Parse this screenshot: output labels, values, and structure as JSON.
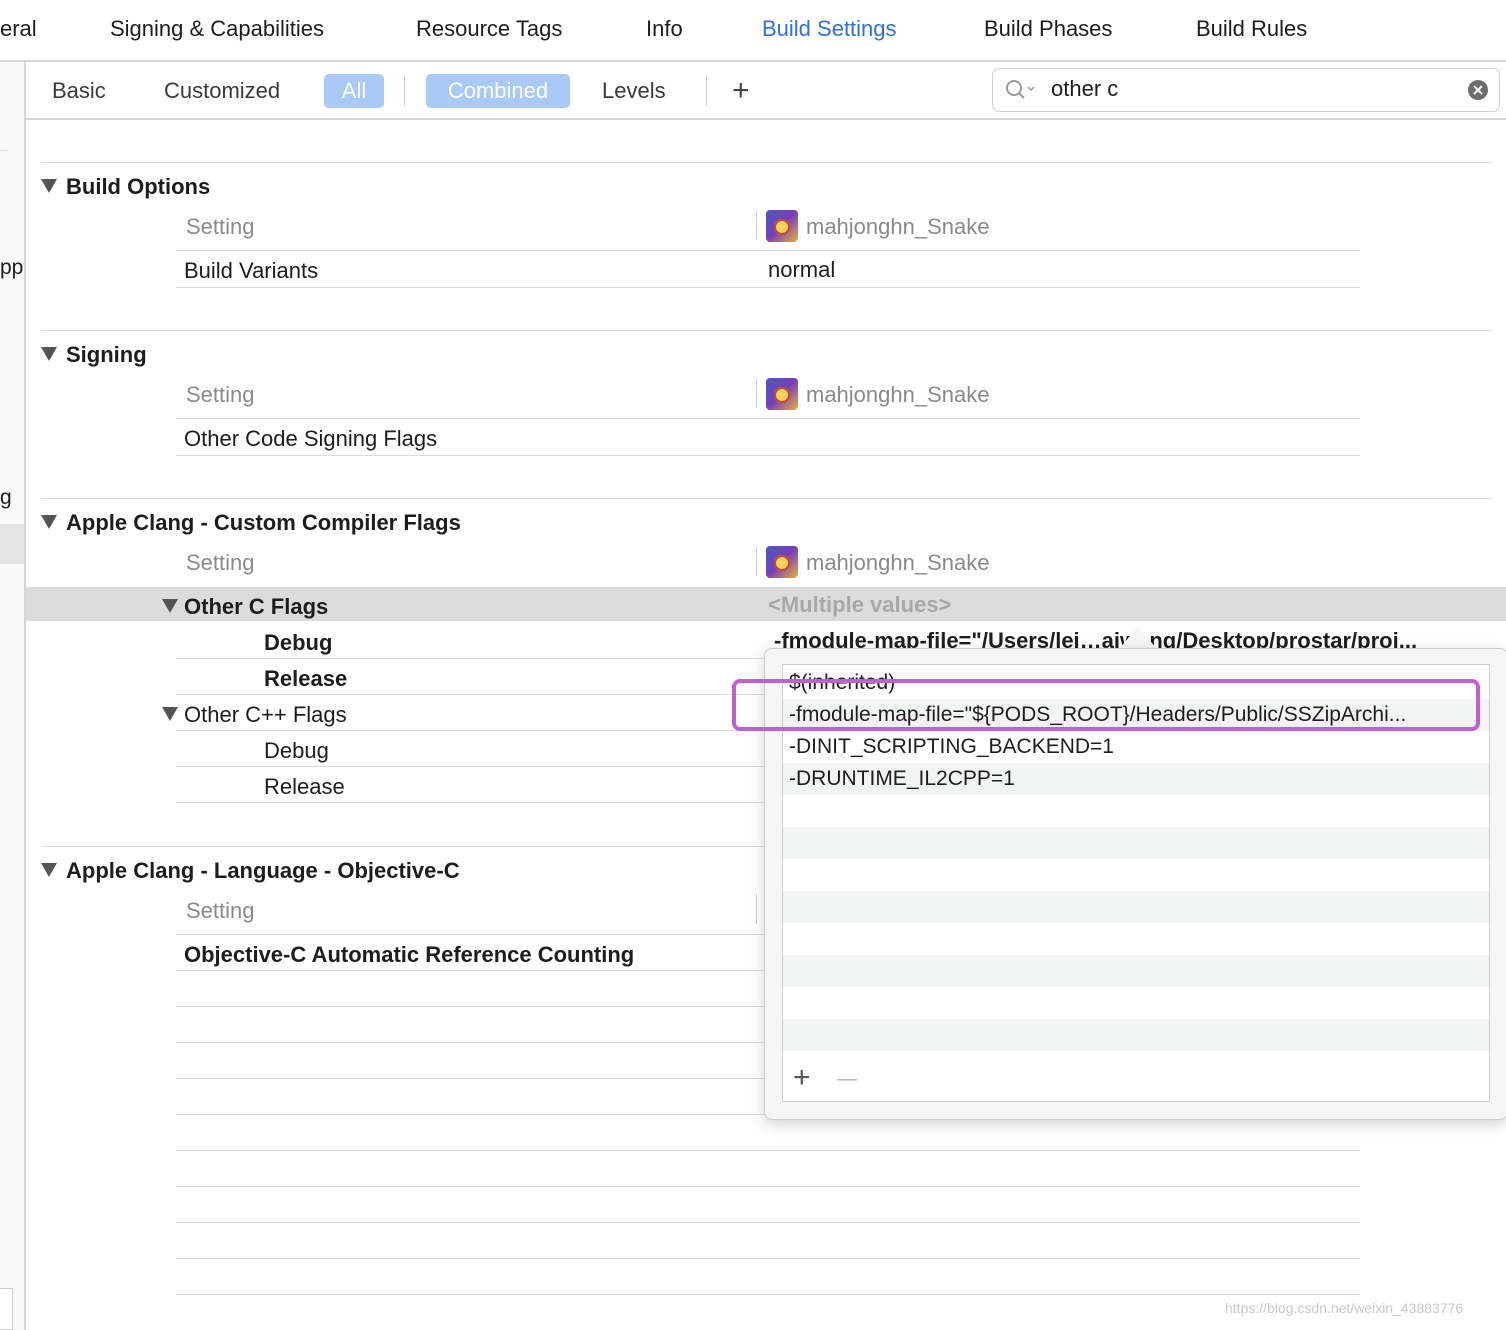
{
  "tabs": [
    {
      "label": "eral"
    },
    {
      "label": "Signing & Capabilities"
    },
    {
      "label": "Resource Tags"
    },
    {
      "label": "Info"
    },
    {
      "label": "Build Settings",
      "active": true
    },
    {
      "label": "Build Phases"
    },
    {
      "label": "Build Rules"
    }
  ],
  "sidebar_fragments": [
    "pp",
    "g"
  ],
  "filter": {
    "basic": "Basic",
    "customized": "Customized",
    "all": "All",
    "combined": "Combined",
    "levels": "Levels",
    "add": "+",
    "search_value": "other c"
  },
  "target_name": "mahjonghn_Snake",
  "setting_header": "Setting",
  "sections": {
    "build_options": {
      "title": "Build Options",
      "rows": [
        {
          "name": "Build Variants",
          "value": "normal"
        }
      ]
    },
    "signing": {
      "title": "Signing",
      "rows": [
        {
          "name": "Other Code Signing Flags",
          "value": ""
        }
      ]
    },
    "clang_flags": {
      "title": "Apple Clang - Custom Compiler Flags",
      "other_c": {
        "name": "Other C Flags",
        "value": "<Multiple values>",
        "debug": "Debug",
        "debug_value": "-fmodule-map-file=\"/Users/lei…aiwang/Desktop/prostar/proj...",
        "release": "Release"
      },
      "other_cpp": {
        "name": "Other C++ Flags",
        "debug": "Debug",
        "release": "Release"
      }
    },
    "objc": {
      "title": "Apple Clang - Language - Objective-C",
      "rows": [
        {
          "name": "Objective-C Automatic Reference Counting"
        }
      ]
    }
  },
  "popover": {
    "items": [
      "$(inherited)",
      "-fmodule-map-file=\"${PODS_ROOT}/Headers/Public/SSZipArchi...",
      "-DINIT_SCRIPTING_BACKEND=1",
      "-DRUNTIME_IL2CPP=1"
    ],
    "add": "+",
    "remove": "—"
  },
  "watermark": "https://blog.csdn.net/weixin_43883776",
  "colors": {
    "accent": "#2f6fe0",
    "selected_button": "#a9caf6",
    "highlight_box": "#c25fc8"
  }
}
